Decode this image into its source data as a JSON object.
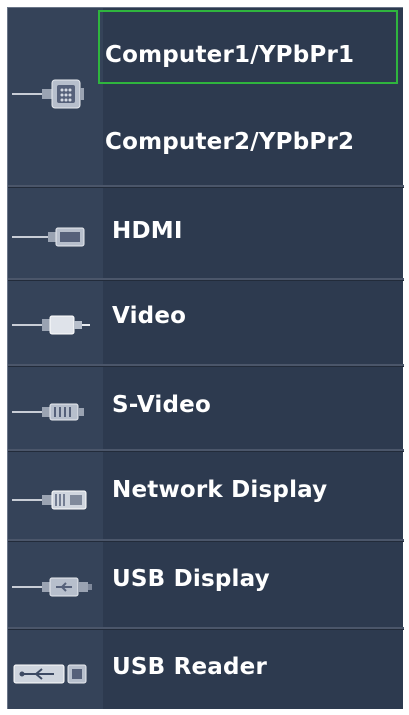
{
  "source_menu": {
    "items": [
      {
        "label": "Computer1/YPbPr1",
        "icon": "vga-connector-icon",
        "selected": true
      },
      {
        "label": "Computer2/YPbPr2",
        "icon": "vga-connector-icon",
        "selected": false
      },
      {
        "label": "HDMI",
        "icon": "hdmi-connector-icon",
        "selected": false
      },
      {
        "label": "Video",
        "icon": "rca-video-connector-icon",
        "selected": false
      },
      {
        "label": "S-Video",
        "icon": "s-video-connector-icon",
        "selected": false
      },
      {
        "label": "Network Display",
        "icon": "rj45-network-connector-icon",
        "selected": false
      },
      {
        "label": "USB Display",
        "icon": "usb-cable-icon",
        "selected": false
      },
      {
        "label": "USB Reader",
        "icon": "usb-port-icon",
        "selected": false
      }
    ],
    "colors": {
      "background": "#2d3a4f",
      "highlight": "#2fb53e",
      "text": "#ffffff"
    }
  }
}
